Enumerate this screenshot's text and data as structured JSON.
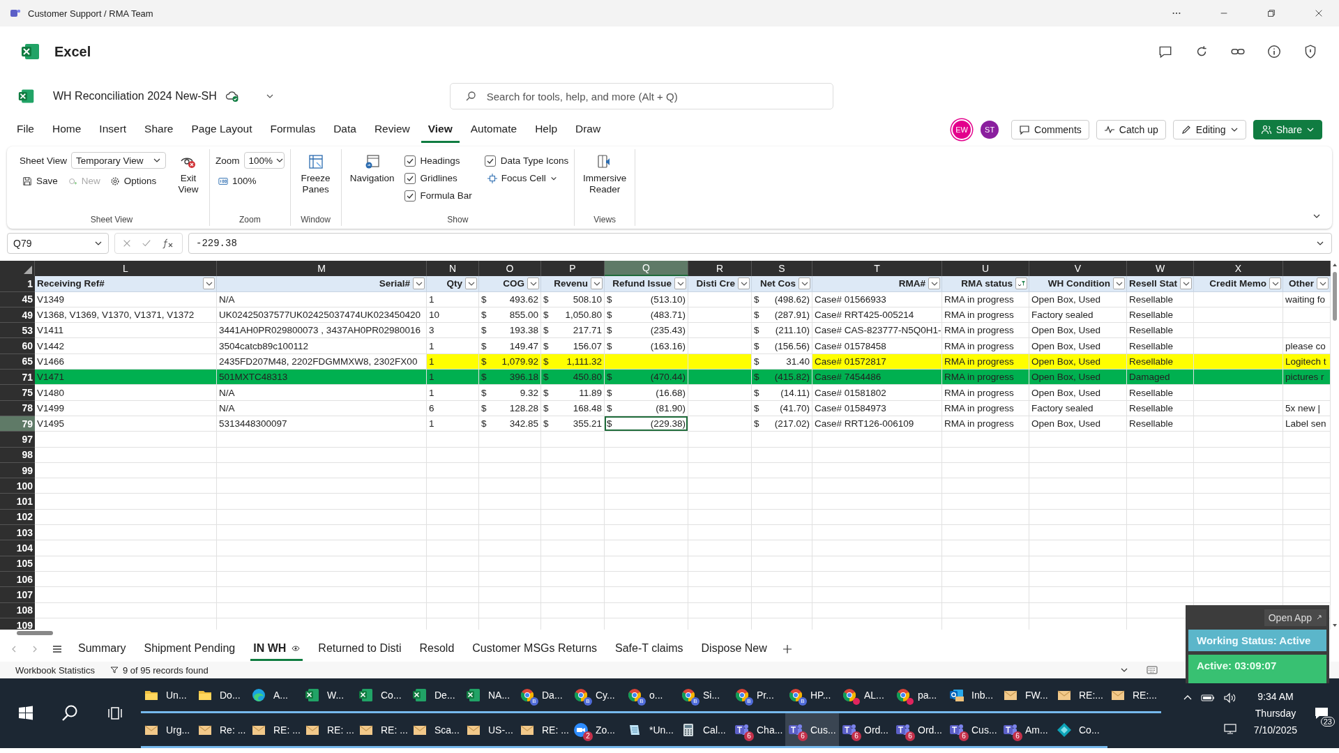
{
  "window": {
    "title": "Customer Support / RMA Team"
  },
  "app": {
    "name": "Excel"
  },
  "document": {
    "name": "WH Reconciliation 2024 New-SH",
    "search_placeholder": "Search for tools, help, and more (Alt + Q)"
  },
  "presence": [
    {
      "initials": "EW",
      "color": "#e3008c"
    },
    {
      "initials": "ST",
      "color": "#8a1f9e"
    }
  ],
  "header_buttons": {
    "comments": "Comments",
    "catch_up": "Catch up",
    "editing": "Editing",
    "share": "Share"
  },
  "ribbon_tabs": [
    {
      "label": "File",
      "selected": false
    },
    {
      "label": "Home",
      "selected": false
    },
    {
      "label": "Insert",
      "selected": false
    },
    {
      "label": "Share",
      "selected": false
    },
    {
      "label": "Page Layout",
      "selected": false
    },
    {
      "label": "Formulas",
      "selected": false
    },
    {
      "label": "Data",
      "selected": false
    },
    {
      "label": "Review",
      "selected": false
    },
    {
      "label": "View",
      "selected": true
    },
    {
      "label": "Automate",
      "selected": false
    },
    {
      "label": "Help",
      "selected": false
    },
    {
      "label": "Draw",
      "selected": false
    }
  ],
  "ribbon": {
    "sheet_view": {
      "label": "Sheet View",
      "field_label": "Sheet View",
      "value": "Temporary View",
      "save": "Save",
      "new": {
        "label": "New",
        "disabled": true
      },
      "options": "Options",
      "exit": "Exit View"
    },
    "zoom": {
      "label": "Zoom",
      "field_label": "Zoom",
      "value": "100%",
      "reset": "100%"
    },
    "window": {
      "label": "Window",
      "freeze": "Freeze Panes"
    },
    "show": {
      "label": "Show",
      "navigation": "Navigation",
      "checkboxes": [
        {
          "label": "Headings",
          "checked": true
        },
        {
          "label": "Gridlines",
          "checked": true
        },
        {
          "label": "Formula Bar",
          "checked": true
        },
        {
          "label": "Data Type Icons",
          "checked": true
        }
      ],
      "focus_cell": "Focus Cell"
    },
    "views": {
      "label": "Views",
      "immersive": "Immersive Reader"
    }
  },
  "formula_bar": {
    "name_box": "Q79",
    "formula": "-229.38"
  },
  "sheet": {
    "header_row": "1",
    "columns": [
      {
        "letter": "L",
        "header": "Receiving Ref#",
        "filtered": false,
        "selected": false
      },
      {
        "letter": "M",
        "header": "Serial#",
        "filtered": false,
        "selected": false
      },
      {
        "letter": "N",
        "header": "Qty",
        "filtered": false,
        "selected": false
      },
      {
        "letter": "O",
        "header": "COG",
        "filtered": false,
        "selected": false
      },
      {
        "letter": "P",
        "header": "Revenu",
        "filtered": false,
        "selected": false
      },
      {
        "letter": "Q",
        "header": "Refund Issue",
        "filtered": false,
        "selected": true
      },
      {
        "letter": "R",
        "header": "Disti Cre",
        "filtered": false,
        "selected": false
      },
      {
        "letter": "S",
        "header": "Net Cos",
        "filtered": false,
        "selected": false
      },
      {
        "letter": "T",
        "header": "RMA#",
        "filtered": false,
        "selected": false
      },
      {
        "letter": "U",
        "header": "RMA status",
        "filtered": true,
        "selected": false
      },
      {
        "letter": "V",
        "header": "WH Condition",
        "filtered": false,
        "selected": false
      },
      {
        "letter": "W",
        "header": "Resell Stat",
        "filtered": false,
        "selected": false
      },
      {
        "letter": "X",
        "header": "Credit Memo",
        "filtered": false,
        "selected": false
      },
      {
        "header": "Other",
        "filtered": false,
        "selected": false
      }
    ],
    "rows": [
      {
        "number": "45",
        "selected": false,
        "cells": [
          "V1349",
          "N/A",
          "1",
          {
            "symbol": "$",
            "amount": "493.62"
          },
          {
            "symbol": "$",
            "amount": "508.10"
          },
          {
            "symbol": "$",
            "amount": "(513.10)"
          },
          null,
          {
            "symbol": "$",
            "amount": "(498.62)"
          },
          "Case# 01566933",
          "RMA in progress",
          "Open Box, Used",
          "Resellable",
          null,
          "waiting fo"
        ]
      },
      {
        "number": "49",
        "selected": false,
        "cells": [
          "V1368, V1369, V1370, V1371, V1372",
          "UK02425037577UK02425037474UK023450420",
          "10",
          {
            "symbol": "$",
            "amount": "855.00"
          },
          {
            "symbol": "$",
            "amount": "1,050.80"
          },
          {
            "symbol": "$",
            "amount": "(483.71)"
          },
          null,
          {
            "symbol": "$",
            "amount": "(287.91)"
          },
          "Case# RRT425-005214",
          "RMA in progress",
          "Factory sealed",
          "Resellable",
          null,
          null
        ]
      },
      {
        "number": "53",
        "selected": false,
        "cells": [
          "V1411",
          "3441AH0PR029800073 , 3437AH0PR02980016",
          "3",
          {
            "symbol": "$",
            "amount": "193.38"
          },
          {
            "symbol": "$",
            "amount": "217.71"
          },
          {
            "symbol": "$",
            "amount": "(235.43)"
          },
          null,
          {
            "symbol": "$",
            "amount": "(211.10)"
          },
          "Case# CAS-823777-N5Q0H1-",
          "RMA in progress",
          "Open Box, Used",
          "Resellable",
          null,
          null
        ]
      },
      {
        "number": "60",
        "selected": false,
        "cells": [
          "V1442",
          "3504catcb89c100112",
          "1",
          {
            "symbol": "$",
            "amount": "149.47"
          },
          {
            "symbol": "$",
            "amount": "156.07"
          },
          {
            "symbol": "$",
            "amount": "(163.16)"
          },
          null,
          {
            "symbol": "$",
            "amount": "(156.56)"
          },
          "Case# 01578458",
          "RMA in progress",
          "Open Box, Used",
          "Resellable",
          null,
          "please co"
        ]
      },
      {
        "number": "65",
        "selected": false,
        "color": "#ffff00",
        "highlighted_cells": [
          false,
          false,
          true,
          true,
          true,
          true,
          true,
          false,
          true,
          true,
          true,
          true,
          true,
          true
        ],
        "cells": [
          "V1466",
          "2435FD207M48, 2202FDGMMXW8, 2302FX00",
          "1",
          {
            "symbol": "$",
            "amount": "1,079.92"
          },
          {
            "symbol": "$",
            "amount": "1,111.32"
          },
          null,
          null,
          {
            "symbol": "$",
            "amount": "31.40"
          },
          "Case# 01572817",
          "RMA in progress",
          "Open Box, Used",
          "Resellable",
          null,
          "Logitech t"
        ]
      },
      {
        "number": "71",
        "selected": false,
        "color": "#00b050",
        "highlighted_cells": [
          true,
          true,
          true,
          true,
          true,
          true,
          true,
          true,
          true,
          true,
          true,
          true,
          true,
          true
        ],
        "cells": [
          "V1471",
          "501MXTC48313",
          "1",
          {
            "symbol": "$",
            "amount": "396.18"
          },
          {
            "symbol": "$",
            "amount": "450.80"
          },
          {
            "symbol": "$",
            "amount": "(470.44)"
          },
          null,
          {
            "symbol": "$",
            "amount": "(415.82)"
          },
          "Case# 7454486",
          "RMA in progress",
          "Open Box, Used",
          "Damaged",
          null,
          "pictures r"
        ]
      },
      {
        "number": "75",
        "selected": false,
        "cells": [
          "V1480",
          "N/A",
          "1",
          {
            "symbol": "$",
            "amount": "9.32"
          },
          {
            "symbol": "$",
            "amount": "11.89"
          },
          {
            "symbol": "$",
            "amount": "(16.68)"
          },
          null,
          {
            "symbol": "$",
            "amount": "(14.11)"
          },
          "Case# 01581802",
          "RMA in progress",
          "Open Box, Used",
          "Resellable",
          null,
          null
        ]
      },
      {
        "number": "78",
        "selected": false,
        "cells": [
          "V1499",
          "N/A",
          "6",
          {
            "symbol": "$",
            "amount": "128.28"
          },
          {
            "symbol": "$",
            "amount": "168.48"
          },
          {
            "symbol": "$",
            "amount": "(81.90)"
          },
          null,
          {
            "symbol": "$",
            "amount": "(41.70)"
          },
          "Case# 01584973",
          "RMA in progress",
          "Factory sealed",
          "Resellable",
          null,
          "5x new |"
        ]
      },
      {
        "number": "79",
        "selected": true,
        "cells": [
          "V1495",
          "5313448300097",
          "1",
          {
            "symbol": "$",
            "amount": "342.85"
          },
          {
            "symbol": "$",
            "amount": "355.21"
          },
          {
            "symbol": "$",
            "amount": "(229.38)"
          },
          null,
          {
            "symbol": "$",
            "amount": "(217.02)"
          },
          "Case# RRT126-006109",
          "RMA in progress",
          "Open Box, Used",
          "Resellable",
          null,
          "Label sen"
        ]
      }
    ],
    "empty_rows": [
      "97",
      "98",
      "99",
      "100",
      "101",
      "102",
      "103",
      "104",
      "105",
      "106",
      "107",
      "108",
      "109"
    ]
  },
  "sheet_tabs": [
    {
      "label": "Summary",
      "selected": false
    },
    {
      "label": "Shipment Pending",
      "selected": false
    },
    {
      "label": "IN WH",
      "selected": true
    },
    {
      "label": "Returned to Disti",
      "selected": false
    },
    {
      "label": "Resold",
      "selected": false
    },
    {
      "label": "Customer MSGs Returns",
      "selected": false
    },
    {
      "label": "Safe-T claims",
      "selected": false
    },
    {
      "label": "Dispose New",
      "selected": false
    }
  ],
  "status_bar": {
    "statistics": "Workbook Statistics",
    "records": "9 of 95 records found"
  },
  "status_widget": {
    "open_app": "Open App",
    "working_status": "Working Status: Active",
    "active_time": "Active: 03:09:07"
  },
  "taskbar": {
    "rows": [
      [
        {
          "kind": "folder",
          "label": "Un..."
        },
        {
          "kind": "folder",
          "label": "Do..."
        },
        {
          "kind": "edge",
          "label": "A..."
        },
        {
          "kind": "excel",
          "label": "W..."
        },
        {
          "kind": "excel",
          "label": "Co..."
        },
        {
          "kind": "excel",
          "label": "De..."
        },
        {
          "kind": "excel",
          "label": "NA..."
        },
        {
          "kind": "chrome",
          "label": "Da...",
          "profile": "B"
        },
        {
          "kind": "chrome",
          "label": "Cy...",
          "profile": "B"
        },
        {
          "kind": "chrome",
          "label": "o...",
          "profile": "B"
        },
        {
          "kind": "chrome",
          "label": "Si...",
          "profile": "B"
        },
        {
          "kind": "chrome",
          "label": "Pr...",
          "profile": "B"
        },
        {
          "kind": "chrome",
          "label": "HP...",
          "profile": "B"
        },
        {
          "kind": "chrome",
          "label": "AL...",
          "alert": true
        },
        {
          "kind": "chrome",
          "label": "pa...",
          "alert": true
        },
        {
          "kind": "outlook",
          "label": "Inb..."
        },
        {
          "kind": "mail",
          "label": "FW..."
        },
        {
          "kind": "mail",
          "label": "RE:..."
        },
        {
          "kind": "mail",
          "label": "RE:..."
        }
      ],
      [
        {
          "kind": "mail",
          "label": "Urg..."
        },
        {
          "kind": "mail",
          "label": "Re: ..."
        },
        {
          "kind": "mail",
          "label": "RE: ..."
        },
        {
          "kind": "mail",
          "label": "RE: ..."
        },
        {
          "kind": "mail",
          "label": "RE: ..."
        },
        {
          "kind": "mail",
          "label": "Sca..."
        },
        {
          "kind": "mail",
          "label": "US-..."
        },
        {
          "kind": "mail",
          "label": "RE: ..."
        },
        {
          "kind": "zoom",
          "label": "Zo...",
          "badge": "2"
        },
        {
          "kind": "notepad",
          "label": "*Un..."
        },
        {
          "kind": "calculator",
          "label": "Cal..."
        },
        {
          "kind": "teams",
          "label": "Cha...",
          "badge": "6"
        },
        {
          "kind": "teams",
          "label": "Cus...",
          "badge": "6",
          "selected": true
        },
        {
          "kind": "teams",
          "label": "Ord...",
          "badge": "6"
        },
        {
          "kind": "teams",
          "label": "Ord...",
          "badge": "6"
        },
        {
          "kind": "teams",
          "label": "Cus...",
          "badge": "6"
        },
        {
          "kind": "teams",
          "label": "Am...",
          "badge": "6"
        },
        {
          "kind": "app",
          "label": "Co..."
        }
      ]
    ],
    "time": "9:34 AM",
    "day": "Thursday",
    "date": "7/10/2025",
    "notifications": "23"
  }
}
